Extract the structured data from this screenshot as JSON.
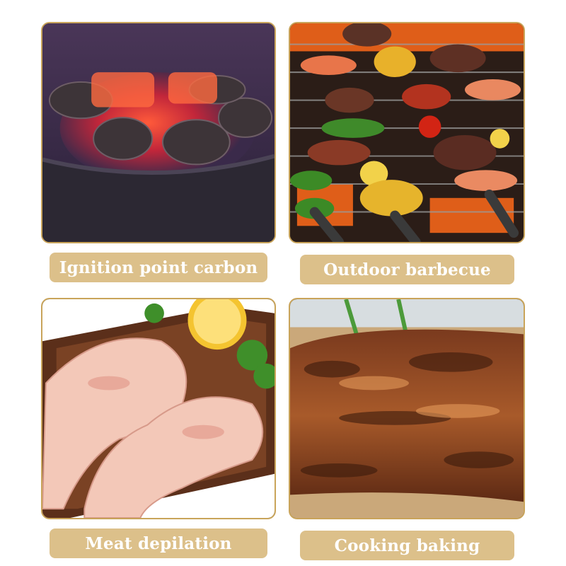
{
  "panels": [
    {
      "caption": "Ignition point carbon",
      "photo": "glowing-charcoal-brazier-photo"
    },
    {
      "caption": "Outdoor barbecue",
      "photo": "grill-skewers-photo"
    },
    {
      "caption": "Meat depilation",
      "photo": "pork-trotters-photo"
    },
    {
      "caption": "Cooking baking",
      "photo": "grilled-meat-photo"
    }
  ],
  "colors": {
    "frame_border": "#c9a45a",
    "label_background": "#dcc08a",
    "label_text": "#ffffff"
  }
}
